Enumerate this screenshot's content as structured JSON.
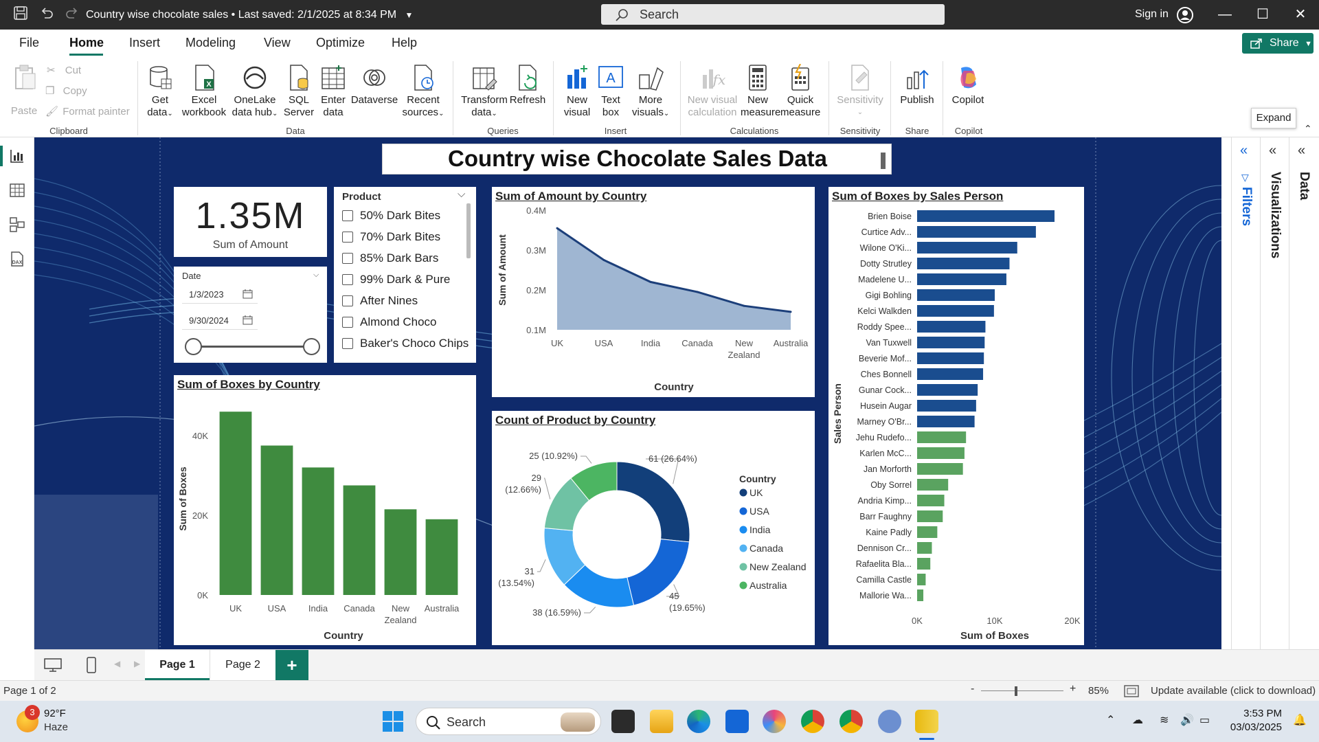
{
  "titlebar": {
    "title": "Country wise chocolate sales",
    "saved": "Last saved: 2/1/2025 at 8:34 PM",
    "search_placeholder": "Search",
    "signin": "Sign in"
  },
  "menu": {
    "items": [
      "File",
      "Home",
      "Insert",
      "Modeling",
      "View",
      "Optimize",
      "Help"
    ],
    "active": "Home",
    "share": "Share"
  },
  "ribbon": {
    "clipboard": {
      "paste": "Paste",
      "cut": "Cut",
      "copy": "Copy",
      "format_painter": "Format painter",
      "group": "Clipboard"
    },
    "data": {
      "get_data": [
        "Get",
        "data"
      ],
      "excel": [
        "Excel",
        "workbook"
      ],
      "onelake": [
        "OneLake",
        "data hub"
      ],
      "sql": [
        "SQL",
        "Server"
      ],
      "enter": [
        "Enter",
        "data"
      ],
      "dataverse": "Dataverse",
      "recent": [
        "Recent",
        "sources"
      ],
      "group": "Data"
    },
    "queries": {
      "transform": [
        "Transform",
        "data"
      ],
      "refresh": "Refresh",
      "group": "Queries"
    },
    "insert": {
      "new_visual": [
        "New",
        "visual"
      ],
      "text_box": [
        "Text",
        "box"
      ],
      "more_visuals": [
        "More",
        "visuals"
      ],
      "group": "Insert"
    },
    "calculations": {
      "new_visual_calc": [
        "New visual",
        "calculation"
      ],
      "new_measure": [
        "New",
        "measure"
      ],
      "quick_measure": [
        "Quick",
        "measure"
      ],
      "group": "Calculations"
    },
    "sensitivity": {
      "label": "Sensitivity",
      "group": "Sensitivity"
    },
    "share": {
      "publish": "Publish",
      "group": "Share"
    },
    "copilot": {
      "label": "Copilot",
      "group": "Copilot"
    },
    "expand_tooltip": "Expand"
  },
  "report": {
    "title": "Country wise Chocolate Sales Data",
    "card": {
      "value": "1.35M",
      "label": "Sum of Amount"
    },
    "date_slicer": {
      "label": "Date",
      "start": "1/3/2023",
      "end": "9/30/2024"
    },
    "product_slicer": {
      "label": "Product",
      "items": [
        "50% Dark Bites",
        "70% Dark Bites",
        "85% Dark Bars",
        "99% Dark & Pure",
        "After Nines",
        "Almond Choco",
        "Baker's Choco Chips"
      ]
    }
  },
  "chart_data": [
    {
      "type": "area",
      "title": "Sum of Amount by Country",
      "xlabel": "Country",
      "ylabel": "Sum of Amount",
      "categories": [
        "UK",
        "USA",
        "India",
        "Canada",
        "New Zealand",
        "Australia"
      ],
      "category_lines": [
        [
          "UK"
        ],
        [
          "USA"
        ],
        [
          "India"
        ],
        [
          "Canada"
        ],
        [
          "New",
          "Zealand"
        ],
        [
          "Australia"
        ]
      ],
      "values": [
        0.355,
        0.275,
        0.22,
        0.195,
        0.16,
        0.145
      ],
      "ylim": [
        0.1,
        0.4
      ],
      "yticks": [
        0.1,
        0.2,
        0.3,
        0.4
      ],
      "ytick_labels": [
        "0.1M",
        "0.2M",
        "0.3M",
        "0.4M"
      ],
      "color": "#1c3f7a",
      "fill": "#9fb6d2"
    },
    {
      "type": "bar",
      "title": "Sum of Boxes by Country",
      "xlabel": "Country",
      "ylabel": "Sum of Boxes",
      "categories": [
        "UK",
        "USA",
        "India",
        "Canada",
        "New Zealand",
        "Australia"
      ],
      "category_lines": [
        [
          "UK"
        ],
        [
          "USA"
        ],
        [
          "India"
        ],
        [
          "Canada"
        ],
        [
          "New",
          "Zealand"
        ],
        [
          "Australia"
        ]
      ],
      "values": [
        46000,
        37500,
        32000,
        27500,
        21500,
        19000
      ],
      "ylim": [
        0,
        50000
      ],
      "yticks": [
        0,
        20000,
        40000
      ],
      "ytick_labels": [
        "0K",
        "20K",
        "40K"
      ],
      "color": "#3f8b3f"
    },
    {
      "type": "pie",
      "title": "Count of Product by Country",
      "legend_title": "Country",
      "slices": [
        {
          "name": "UK",
          "value": 61,
          "label": [
            "61 (26.64%)"
          ],
          "color": "#123f7a"
        },
        {
          "name": "USA",
          "value": 45,
          "label": [
            "45",
            "(19.65%)"
          ],
          "color": "#1466d6"
        },
        {
          "name": "India",
          "value": 38,
          "label": [
            "38 (16.59%)"
          ],
          "color": "#1a8cf0"
        },
        {
          "name": "Canada",
          "value": 31,
          "label": [
            "31",
            "(13.54%)"
          ],
          "color": "#52b2f2"
        },
        {
          "name": "New Zealand",
          "value": 29,
          "label": [
            "29",
            "(12.66%)"
          ],
          "color": "#6fc2a4"
        },
        {
          "name": "Australia",
          "value": 25,
          "label": [
            "25 (10.92%)"
          ],
          "color": "#4cb562"
        }
      ]
    },
    {
      "type": "bar",
      "orientation": "horizontal",
      "title": "Sum of Boxes by Sales Person",
      "xlabel": "Sum of Boxes",
      "ylabel": "Sales Person",
      "categories": [
        "Brien Boise",
        "Curtice Adv...",
        "Wilone O'Ki...",
        "Dotty Strutley",
        "Madelene U...",
        "Gigi Bohling",
        "Kelci Walkden",
        "Roddy Spee...",
        "Van Tuxwell",
        "Beverie Mof...",
        "Ches Bonnell",
        "Gunar Cock...",
        "Husein Augar",
        "Marney O'Br...",
        "Jehu Rudefo...",
        "Karlen McC...",
        "Jan Morforth",
        "Oby Sorrel",
        "Andria Kimp...",
        "Barr Faughny",
        "Kaine Padly",
        "Dennison Cr...",
        "Rafaelita Bla...",
        "Camilla Castle",
        "Mallorie Wa..."
      ],
      "values": [
        17700,
        15300,
        12900,
        11900,
        11500,
        10000,
        9900,
        8800,
        8700,
        8600,
        8500,
        7800,
        7600,
        7400,
        6300,
        6100,
        5900,
        4000,
        3500,
        3300,
        2600,
        1900,
        1700,
        1100,
        800
      ],
      "xlim": [
        0,
        20000
      ],
      "xticks": [
        0,
        10000,
        20000
      ],
      "xtick_labels": [
        "0K",
        "10K",
        "20K"
      ],
      "color_top": "#1a4d8f",
      "color_bottom": "#5aa360",
      "top_count": 14
    }
  ],
  "tabs": {
    "page1": "Page 1",
    "page2": "Page 2",
    "add": "+"
  },
  "status": {
    "page": "Page 1 of 2",
    "zoom": "85%",
    "update": "Update available (click to download)"
  },
  "taskbar": {
    "temp": "92°F",
    "weather": "Haze",
    "badge": "3",
    "search": "Search",
    "time": "3:53 PM",
    "date": "03/03/2025"
  },
  "panes": {
    "filters": "Filters",
    "visualizations": "Visualizations",
    "data": "Data"
  },
  "colors": {
    "accent": "#117865",
    "report_bg": "#0f2a6b"
  }
}
